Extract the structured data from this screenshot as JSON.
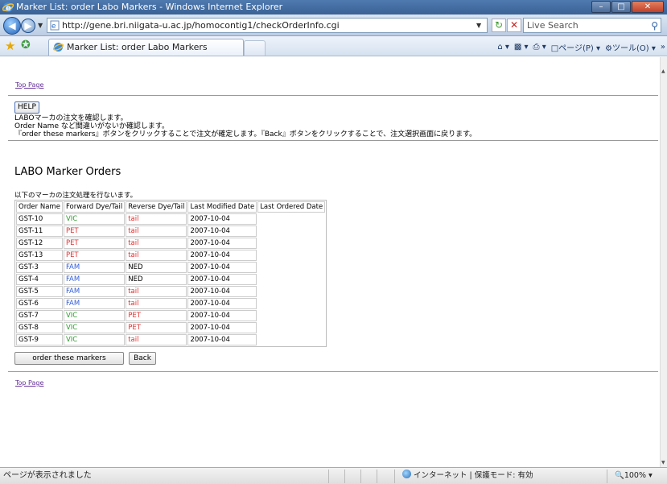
{
  "window": {
    "title": "Marker List: order Labo Markers - Windows Internet Explorer"
  },
  "address_bar": {
    "url": "http://gene.bri.niigata-u.ac.jp/homocontig1/checkOrderInfo.cgi",
    "search_placeholder": "Live Search"
  },
  "tab": {
    "title": "Marker List: order Labo Markers"
  },
  "command_bar": {
    "page": "ページ(P)",
    "tools": "ツール(O)"
  },
  "page": {
    "top_link": "Top Page",
    "help_button": "HELP",
    "description": [
      "LABOマーカの注文を確認します。",
      "Order Name など間違いがないか確認します。",
      "『order these markers』ボタンをクリックすることで注文が確定します。『Back』ボタンをクリックすることで、注文選択画面に戻ります。"
    ],
    "heading": "LABO Marker Orders",
    "notice": "以下のマーカの注文処理を行ないます。",
    "table": {
      "headers": [
        "Order Name",
        "Forward Dye/Tail",
        "Reverse Dye/Tail",
        "Last Modified Date",
        "Last Ordered Date"
      ],
      "rows": [
        {
          "name": "GST-10",
          "fwd": "VIC",
          "fwd_color": "#2e9a2e",
          "rev": "tail",
          "rev_color": "#e03030",
          "modified": "2007-10-04",
          "ordered": ""
        },
        {
          "name": "GST-11",
          "fwd": "PET",
          "fwd_color": "#e03030",
          "rev": "tail",
          "rev_color": "#e03030",
          "modified": "2007-10-04",
          "ordered": ""
        },
        {
          "name": "GST-12",
          "fwd": "PET",
          "fwd_color": "#e03030",
          "rev": "tail",
          "rev_color": "#e03030",
          "modified": "2007-10-04",
          "ordered": ""
        },
        {
          "name": "GST-13",
          "fwd": "PET",
          "fwd_color": "#e03030",
          "rev": "tail",
          "rev_color": "#e03030",
          "modified": "2007-10-04",
          "ordered": ""
        },
        {
          "name": "GST-3",
          "fwd": "FAM",
          "fwd_color": "#2f5bdc",
          "rev": "NED",
          "rev_color": "#000000",
          "modified": "2007-10-04",
          "ordered": ""
        },
        {
          "name": "GST-4",
          "fwd": "FAM",
          "fwd_color": "#2f5bdc",
          "rev": "NED",
          "rev_color": "#000000",
          "modified": "2007-10-04",
          "ordered": ""
        },
        {
          "name": "GST-5",
          "fwd": "FAM",
          "fwd_color": "#2f5bdc",
          "rev": "tail",
          "rev_color": "#e03030",
          "modified": "2007-10-04",
          "ordered": ""
        },
        {
          "name": "GST-6",
          "fwd": "FAM",
          "fwd_color": "#2f5bdc",
          "rev": "tail",
          "rev_color": "#e03030",
          "modified": "2007-10-04",
          "ordered": ""
        },
        {
          "name": "GST-7",
          "fwd": "VIC",
          "fwd_color": "#2e9a2e",
          "rev": "PET",
          "rev_color": "#e03030",
          "modified": "2007-10-04",
          "ordered": ""
        },
        {
          "name": "GST-8",
          "fwd": "VIC",
          "fwd_color": "#2e9a2e",
          "rev": "PET",
          "rev_color": "#e03030",
          "modified": "2007-10-04",
          "ordered": ""
        },
        {
          "name": "GST-9",
          "fwd": "VIC",
          "fwd_color": "#2e9a2e",
          "rev": "tail",
          "rev_color": "#e03030",
          "modified": "2007-10-04",
          "ordered": ""
        }
      ]
    },
    "order_button": "order these markers",
    "back_button": "Back"
  },
  "status_bar": {
    "text": "ページが表示されました",
    "zone": "インターネット | 保護モード: 有効",
    "zoom": "100%"
  }
}
